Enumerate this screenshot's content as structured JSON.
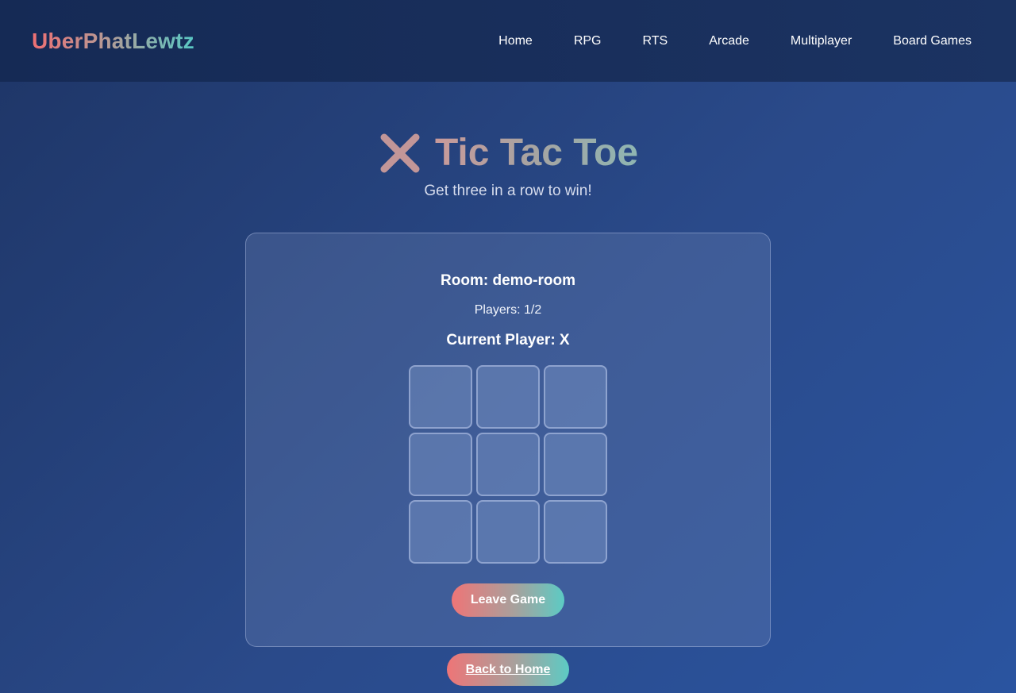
{
  "header": {
    "logo": "UberPhatLewtz",
    "nav": [
      {
        "label": "Home"
      },
      {
        "label": "RPG"
      },
      {
        "label": "RTS"
      },
      {
        "label": "Arcade"
      },
      {
        "label": "Multiplayer"
      },
      {
        "label": "Board Games"
      }
    ]
  },
  "hero": {
    "icon": "x-mark-icon",
    "title": "Tic Tac Toe",
    "subtitle": "Get three in a row to win!"
  },
  "game": {
    "room": "Room: demo-room",
    "players": "Players: 1/2",
    "current_player": "Current Player: X",
    "board": [
      "",
      "",
      "",
      "",
      "",
      "",
      "",
      "",
      ""
    ],
    "leave_label": "Leave Game"
  },
  "footer": {
    "back_label": "Back to Home"
  },
  "colors": {
    "accent_start": "#ee7577",
    "accent_end": "#5ccbc4",
    "background": "#2a4a8a",
    "header": "#192f5c"
  }
}
